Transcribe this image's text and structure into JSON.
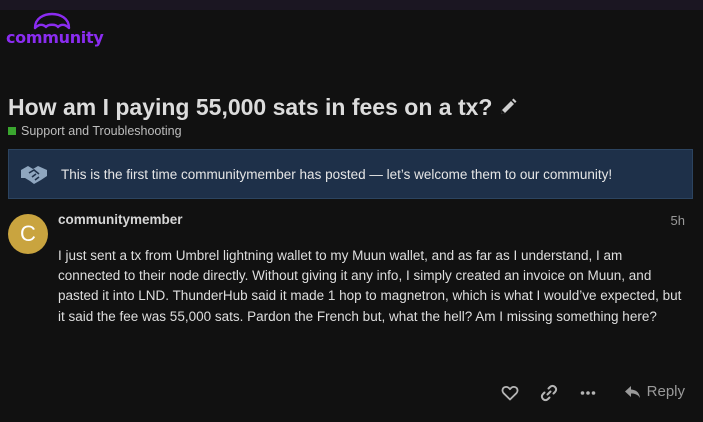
{
  "site": {
    "logo_text": "community"
  },
  "topic": {
    "title": "How am I paying 55,000 sats in fees on a tx?",
    "category": "Support and Troubleshooting",
    "category_color": "#3aa62f"
  },
  "notice": {
    "text": "This is the first time communitymember has posted — let’s welcome them to our community!"
  },
  "post": {
    "avatar_letter": "C",
    "avatar_color": "#c9a43f",
    "username": "communitymember",
    "time": "5h",
    "body": "I just sent a tx from Umbrel lightning wallet to my Muun wallet, and as far as I understand, I am connected to their node directly. Without giving it any info, I simply created an invoice on Muun, and pasted it into LND. ThunderHub said it made 1 hop to magnetron, which is what I would’ve expected, but it said the fee was 55,000 sats. Pardon the French but, what the hell? Am I missing something here?"
  },
  "actions": {
    "like_icon": "heart-icon",
    "share_icon": "link-icon",
    "more_icon": "ellipsis-icon",
    "reply_label": "Reply"
  },
  "colors": {
    "brand": "#8a2cf0",
    "notice_bg": "#1e3049"
  }
}
